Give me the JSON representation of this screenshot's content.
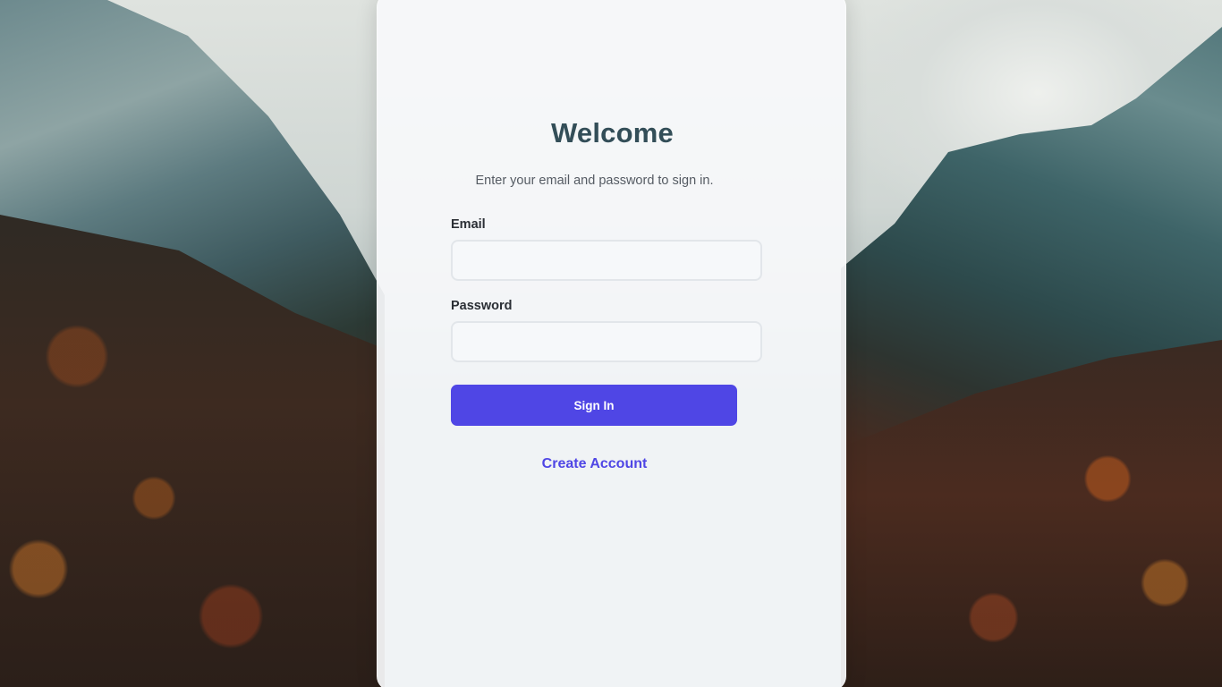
{
  "login": {
    "title": "Welcome",
    "subtitle": "Enter your email and password to sign in.",
    "email_label": "Email",
    "email_value": "",
    "password_label": "Password",
    "password_value": "",
    "signin_label": "Sign In",
    "create_account_label": "Create Account"
  },
  "colors": {
    "accent": "#4f46e5",
    "title": "#334e58",
    "card_bg": "#f8f9fb"
  }
}
